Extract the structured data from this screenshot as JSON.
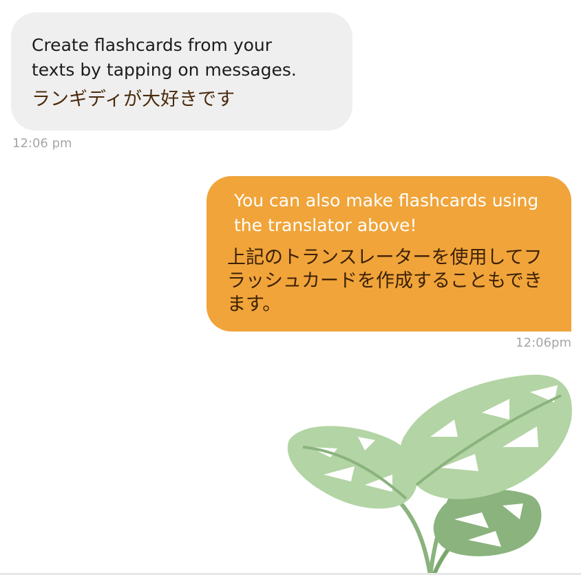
{
  "messages": [
    {
      "direction": "incoming",
      "text": "Create flashcards from your\ntexts by tapping on messages.",
      "translation": "ランギディが大好きです",
      "timestamp": "12:06 pm"
    },
    {
      "direction": "outgoing",
      "text": "You can also  make flashcards using\nthe translator above!",
      "translation": "上記のトランスレーターを使用してフ\nラッシュカードを作成することもでき\nます。",
      "timestamp": "12:06pm"
    }
  ],
  "decoration": {
    "illustration": "monstera-leaves-icon"
  },
  "colors": {
    "incoming_bubble": "#efefef",
    "outgoing_bubble": "#f0a43a",
    "timestamp": "#a6a6a6",
    "leaf_light": "#b3d4a4",
    "leaf_dark": "#8ab37d"
  }
}
